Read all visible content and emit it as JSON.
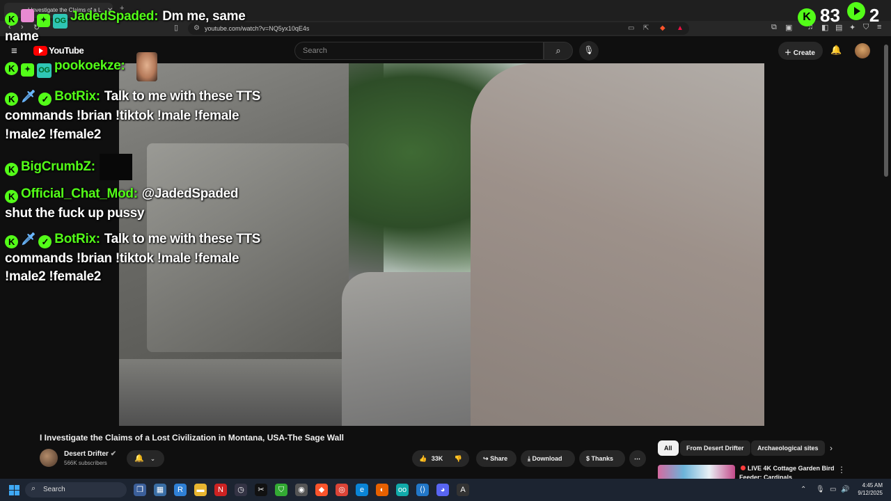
{
  "browser": {
    "tab_title": "I Investigate the Claims of a L",
    "url": "youtube.com/watch?v=NQ5yx10qE4s"
  },
  "youtube": {
    "logo_text": "YouTube",
    "search_placeholder": "Search",
    "create_label": "Create"
  },
  "stream_overlay": {
    "stats": {
      "viewers": "83",
      "second": "2"
    },
    "chat": [
      {
        "user": "JadedSpaded:",
        "message": "Dm me, same"
      },
      {
        "user": "",
        "message": "name"
      },
      {
        "user": "pookoekze:",
        "message": ""
      },
      {
        "user": "BotRix:",
        "message": "Talk to me with these TTS"
      },
      {
        "user": "",
        "message": "commands !brian !tiktok !male !female"
      },
      {
        "user": "",
        "message": "!male2 !female2"
      },
      {
        "user": "BigCrumbZ:",
        "message": ""
      },
      {
        "user": "Official_Chat_Mod:",
        "message": "@JadedSpaded"
      },
      {
        "user": "",
        "message": "shut the fuck up pussy"
      },
      {
        "user": "BotRix:",
        "message": "Talk to me with these TTS"
      },
      {
        "user": "",
        "message": "commands !brian !tiktok !male !female"
      },
      {
        "user": "",
        "message": "!male2 !female2"
      }
    ]
  },
  "video": {
    "title": "I Investigate the Claims of a Lost Civilization in Montana, USA-The Sage Wall",
    "channel_name": "Desert Drifter",
    "subscribers": "566K subscribers",
    "likes": "33K",
    "share_label": "Share",
    "download_label": "Download",
    "thanks_label": "Thanks"
  },
  "chips": [
    "All",
    "From Desert Drifter",
    "Archaeological sites"
  ],
  "recommendation": {
    "title_line1": "LIVE 4K Cottage Garden Bird",
    "title_line2": "Feeder: Cardinals"
  },
  "taskbar": {
    "search_label": "Search",
    "time": "4:45 AM",
    "date": "9/12/2025"
  }
}
